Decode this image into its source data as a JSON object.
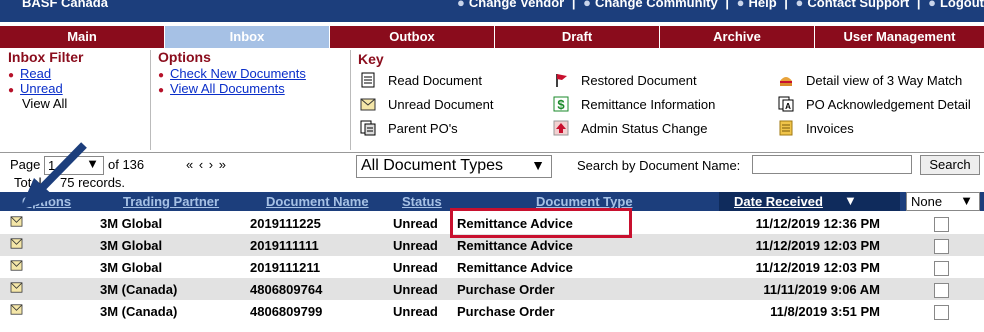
{
  "header": {
    "brand": "BASF Canada",
    "links": [
      "Change Vendor",
      "Change Community",
      "Help",
      "Contact Support",
      "Logout"
    ]
  },
  "tabs": [
    "Main",
    "Inbox",
    "Outbox",
    "Draft",
    "Archive",
    "User Management"
  ],
  "inbox_filter": {
    "title": "Inbox Filter",
    "items": [
      "Read",
      "Unread"
    ],
    "current": "View All"
  },
  "options": {
    "title": "Options",
    "items": [
      "Check New Documents",
      "View All Documents"
    ]
  },
  "key": {
    "title": "Key",
    "col1": [
      "Read Document",
      "Unread Document",
      "Parent PO's"
    ],
    "col2": [
      "Restored Document",
      "Remittance Information",
      "Admin Status Change"
    ],
    "col3": [
      "Detail view of 3 Way Match",
      "PO Acknowledgement Detail",
      "Invoices"
    ]
  },
  "pager": {
    "page_label": "Page",
    "page_value": "1",
    "of_text": "of 136",
    "nav": "«  ‹  ›  »",
    "records_prefix": "Total",
    "records_suffix": "75 records.",
    "doc_type_value": "All Document Types",
    "search_label": "Search by Document Name:",
    "search_value": "",
    "search_button": "Search"
  },
  "grid": {
    "headers": {
      "options": "Options",
      "partner": "Trading Partner",
      "docname": "Document Name",
      "status": "Status",
      "doctype": "Document Type",
      "date": "Date Received"
    },
    "none_select": "None",
    "rows": [
      {
        "partner": "3M Global",
        "docname": "2019111225",
        "status": "Unread",
        "doctype": "Remittance Advice",
        "date": "11/12/2019 12:36 PM"
      },
      {
        "partner": "3M Global",
        "docname": "2019111111",
        "status": "Unread",
        "doctype": "Remittance Advice",
        "date": "11/12/2019 12:03 PM"
      },
      {
        "partner": "3M Global",
        "docname": "2019111211",
        "status": "Unread",
        "doctype": "Remittance Advice",
        "date": "11/12/2019 12:03 PM"
      },
      {
        "partner": "3M (Canada)",
        "docname": "4806809764",
        "status": "Unread",
        "doctype": "Purchase Order",
        "date": "11/11/2019 9:06 AM"
      },
      {
        "partner": "3M (Canada)",
        "docname": "4806809799",
        "status": "Unread",
        "doctype": "Purchase Order",
        "date": "11/8/2019 3:51 PM"
      }
    ]
  },
  "colors": {
    "nav": "#1c3e7c",
    "tab_red": "#8a0c1c",
    "tab_active": "#a6c1e5",
    "highlight": "#c8102e",
    "arrow": "#1c3e7c"
  }
}
